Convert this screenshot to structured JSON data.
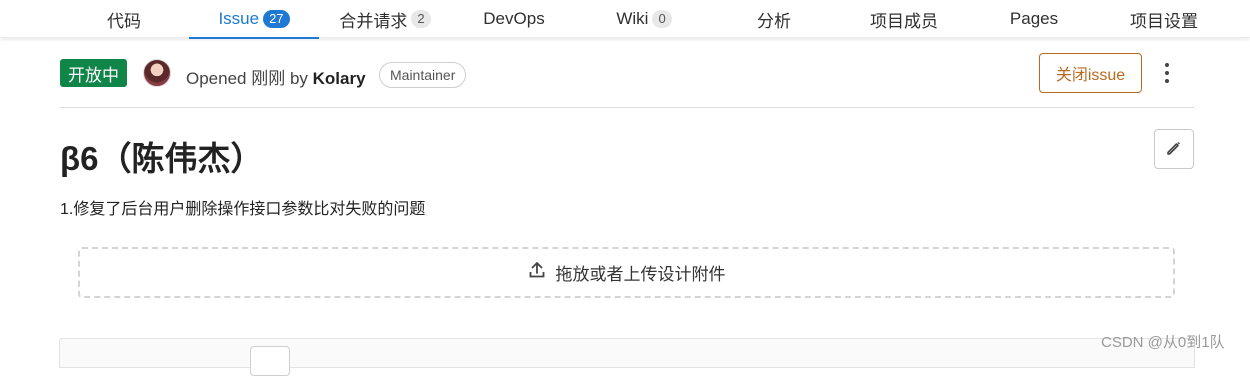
{
  "tabs": [
    {
      "label": "代码",
      "count": null
    },
    {
      "label": "Issue",
      "count": "27",
      "active": true
    },
    {
      "label": "合并请求",
      "count": "2"
    },
    {
      "label": "DevOps",
      "count": null
    },
    {
      "label": "Wiki",
      "count": "0"
    },
    {
      "label": "分析",
      "count": null
    },
    {
      "label": "项目成员",
      "count": null
    },
    {
      "label": "Pages",
      "count": null
    },
    {
      "label": "项目设置",
      "count": null
    }
  ],
  "issue": {
    "status": "开放中",
    "opened_prefix": "Opened 刚刚 by",
    "author": "Kolary",
    "role": "Maintainer",
    "close_label": "关闭issue",
    "title": "β6（陈伟杰）",
    "description": "1.修复了后台用户删除操作接口参数比对失败的问题"
  },
  "upload": {
    "label": "拖放或者上传设计附件",
    "icon": "upload-icon"
  },
  "watermark": "CSDN @从0到1队",
  "colors": {
    "accent": "#1f78d1",
    "status": "#108548",
    "close": "#b86b1f"
  }
}
